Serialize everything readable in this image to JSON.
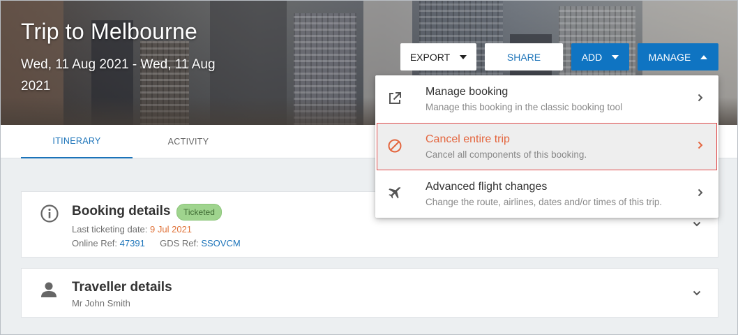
{
  "trip": {
    "title": "Trip to Melbourne",
    "dates": "Wed, 11 Aug 2021 - Wed, 11 Aug 2021"
  },
  "actions": {
    "export_label": "EXPORT",
    "share_label": "SHARE",
    "add_label": "ADD",
    "manage_label": "MANAGE"
  },
  "tabs": [
    {
      "label": "ITINERARY",
      "active": true
    },
    {
      "label": "ACTIVITY",
      "active": false
    }
  ],
  "booking": {
    "title": "Booking details",
    "status": "Ticketed",
    "last_ticketing_label": "Last ticketing date:",
    "last_ticketing_value": "9 Jul 2021",
    "online_ref_label": "Online Ref:",
    "online_ref_value": "47391",
    "gds_ref_label": "GDS Ref:",
    "gds_ref_value": "SSOVCM"
  },
  "traveller": {
    "title": "Traveller details",
    "name": "Mr John Smith"
  },
  "manage_menu": {
    "items": [
      {
        "icon": "external-link-icon",
        "title": "Manage booking",
        "description": "Manage this booking in the classic booking tool"
      },
      {
        "icon": "ban-icon",
        "title": "Cancel entire trip",
        "description": "Cancel all components of this booking."
      },
      {
        "icon": "airplane-icon",
        "title": "Advanced flight changes",
        "description": "Change the route, airlines, dates and/or times of this trip."
      }
    ]
  },
  "colors": {
    "primary": "#0f74c2",
    "link": "#1b73b9",
    "danger": "#e4663f",
    "ticketed_badge": "#9fd48e",
    "accent_orange": "#e0733a"
  }
}
